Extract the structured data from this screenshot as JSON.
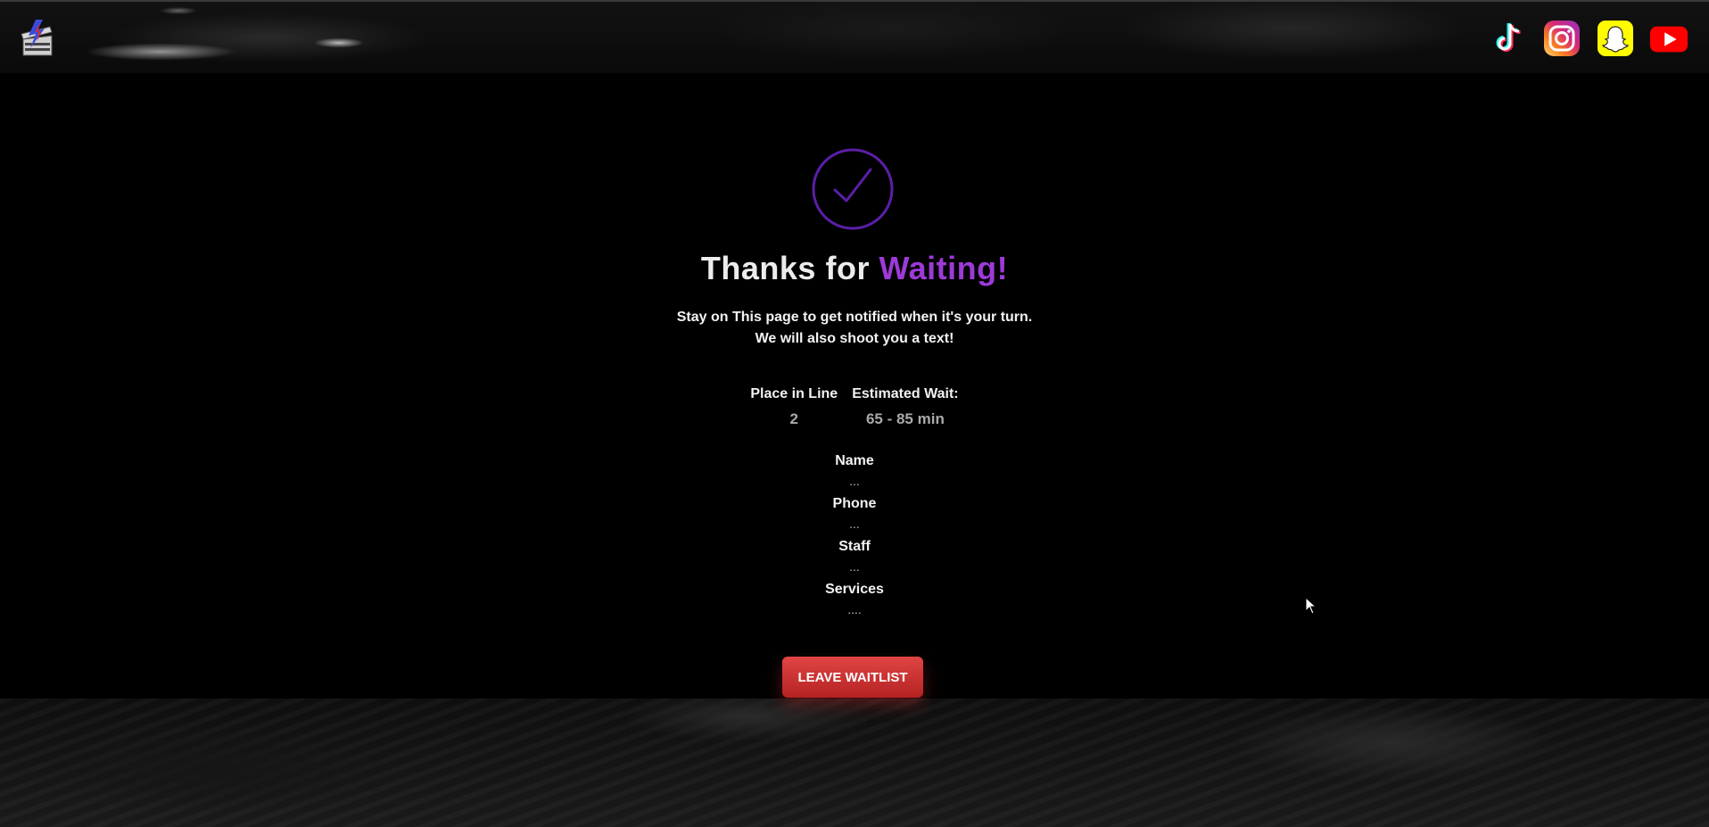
{
  "header": {
    "logo_icon": "clapperboard-lightning-logo-icon",
    "social": [
      {
        "name": "tiktok",
        "icon": "tiktok-icon"
      },
      {
        "name": "instagram",
        "icon": "instagram-icon"
      },
      {
        "name": "snapchat",
        "icon": "snapchat-icon"
      },
      {
        "name": "youtube",
        "icon": "youtube-icon"
      }
    ]
  },
  "main": {
    "check_icon": "checkmark-circle-icon",
    "title_part1": "Thanks for ",
    "title_part2": "Waiting!",
    "subtitle_line1": "Stay on This page to get notified when it's your turn.",
    "subtitle_line2": "We will also shoot you a text!",
    "place_label": "Place in Line",
    "place_value": "2",
    "wait_label": "Estimated Wait:",
    "wait_value": "65 - 85 min",
    "details": {
      "name_label": "Name",
      "name_value": "...",
      "phone_label": "Phone",
      "phone_value": "...",
      "staff_label": "Staff",
      "staff_value": "...",
      "services_label": "Services",
      "services_value": "...."
    },
    "leave_button": "LEAVE WAITLIST"
  },
  "colors": {
    "accent_purple": "#9d3ad8",
    "check_stroke": "#5b1fa8",
    "button_red": "#d23535",
    "background": "#000000"
  }
}
